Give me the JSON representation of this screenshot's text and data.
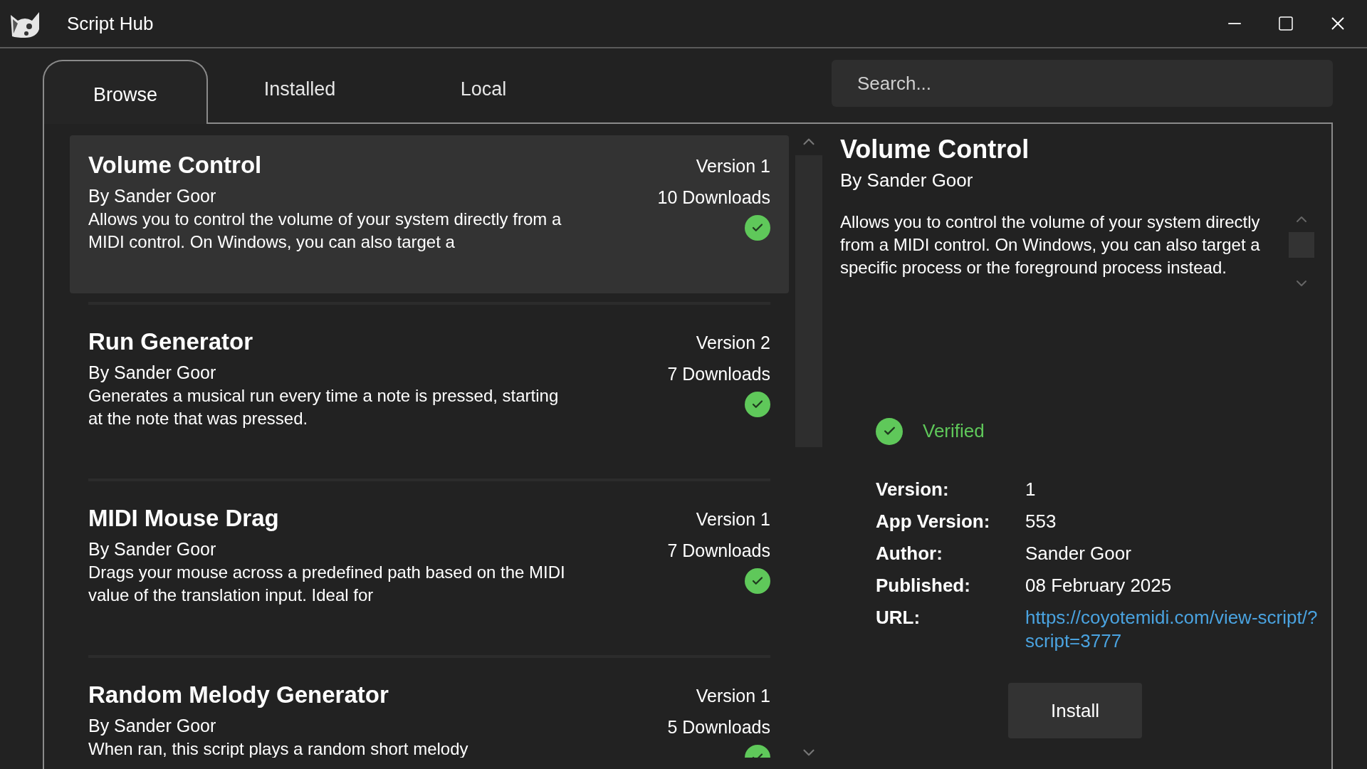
{
  "window": {
    "title": "Script Hub"
  },
  "tabs": [
    {
      "label": "Browse",
      "selected": true
    },
    {
      "label": "Installed",
      "selected": false
    },
    {
      "label": "Local",
      "selected": false
    }
  ],
  "search": {
    "placeholder": "Search..."
  },
  "scripts": [
    {
      "name": "Volume Control",
      "author": "By Sander Goor",
      "version": "Version 1",
      "downloads": "10 Downloads",
      "description": "Allows you to control the volume of your system directly from a MIDI control. On Windows, you can also target a",
      "verified": true,
      "selected": true
    },
    {
      "name": "Run Generator",
      "author": "By Sander Goor",
      "version": "Version 2",
      "downloads": "7 Downloads",
      "description": "Generates a musical run every time a note is pressed, starting at the note that was pressed.",
      "verified": true,
      "selected": false
    },
    {
      "name": "MIDI Mouse Drag",
      "author": "By Sander Goor",
      "version": "Version 1",
      "downloads": "7 Downloads",
      "description": "Drags your mouse across a predefined path based on the MIDI value of the translation input. Ideal for",
      "verified": true,
      "selected": false
    },
    {
      "name": "Random Melody Generator",
      "author": "By Sander Goor",
      "version": "Version 1",
      "downloads": "5 Downloads",
      "description": "When ran, this script plays a random short melody",
      "verified": true,
      "selected": false
    }
  ],
  "detail": {
    "title": "Volume Control",
    "author": "By Sander Goor",
    "description": "Allows you to control the volume of your system directly from a MIDI control. On Windows, you can also target a specific process or the foreground process instead.",
    "verified": true,
    "verified_label": "Verified",
    "fields": [
      {
        "label": "Version:",
        "value": "1"
      },
      {
        "label": "App Version:",
        "value": "553"
      },
      {
        "label": "Author:",
        "value": "Sander Goor"
      },
      {
        "label": "Published:",
        "value": "08 February 2025"
      },
      {
        "label": "URL:",
        "value": "https://coyotemidi.com/view-script/?script=3777",
        "kind": "link"
      }
    ],
    "install_button": "Install"
  }
}
